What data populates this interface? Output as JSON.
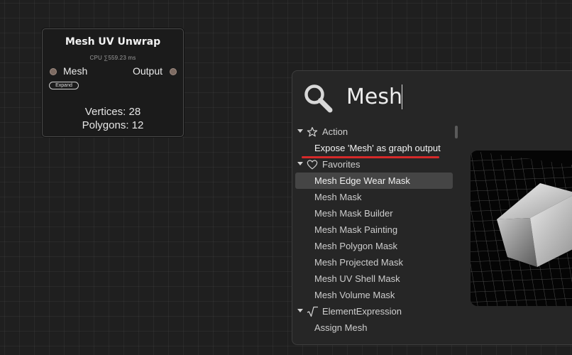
{
  "node": {
    "title": "Mesh UV Unwrap",
    "cpu": "CPU ∑559.23 ms",
    "input_port": "Mesh",
    "output_port": "Output",
    "expand_label": "Expand",
    "vertices": "Vertices: 28",
    "polygons": "Polygons: 12"
  },
  "search": {
    "value": "Mesh",
    "placeholder": ""
  },
  "categories": {
    "action": "Action",
    "favorites": "Favorites",
    "element_expression": "ElementExpression"
  },
  "items": {
    "expose": "Expose 'Mesh' as graph output",
    "favorites": [
      "Mesh Edge Wear Mask",
      "Mesh Mask",
      "Mesh Mask Builder",
      "Mesh Mask Painting",
      "Mesh Polygon Mask",
      "Mesh Projected Mask",
      "Mesh UV Shell Mask",
      "Mesh Volume Mask"
    ],
    "assign_mesh": "Assign Mesh"
  },
  "icons": {
    "search": "search-icon",
    "action": "star-icon",
    "favorites": "heart-icon",
    "element_expression": "square-root-icon"
  },
  "colors": {
    "highlight_underline": "#d62a2a",
    "selection": "#454545"
  }
}
